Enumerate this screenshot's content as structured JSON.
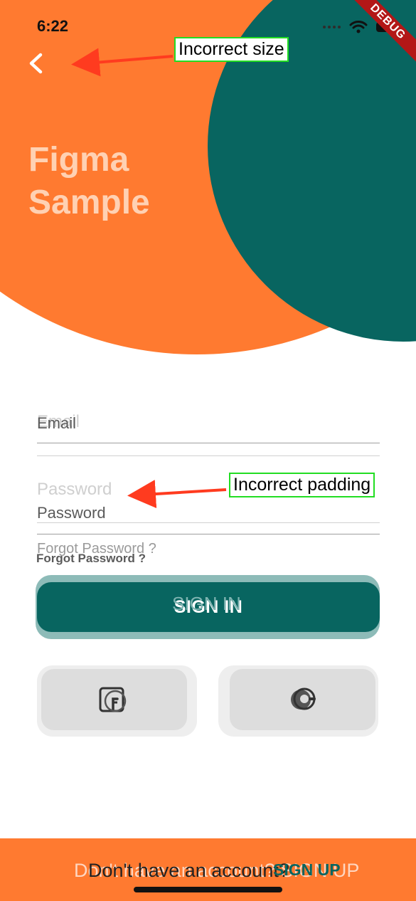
{
  "status_bar": {
    "time": "6:22"
  },
  "debug_ribbon": "DEBUG",
  "annotations": {
    "top": "Incorrect size",
    "middle": "Incorrect padding"
  },
  "title": {
    "line1": "Figma",
    "line2": "Sample"
  },
  "form": {
    "email_ghost": "Email",
    "email_label": "Email",
    "password_ghost": "Password",
    "password_label": "Password",
    "forgot_ghost": "Forgot Password ?",
    "forgot_label": "Forgot Password ?",
    "signin_ghost": "SIGN IN",
    "signin_label": "SIGN IN"
  },
  "social": {
    "facebook_icon": "facebook-icon",
    "google_icon": "google-icon"
  },
  "footer": {
    "ghost_text": "Don't have an account? SIGN UP",
    "text": "Don't have an account?",
    "signup": "SIGN UP"
  },
  "colors": {
    "orange": "#FF7A30",
    "teal": "#086560",
    "annotation_border": "#22dd22",
    "annotation_arrow": "#ff3b1f"
  }
}
